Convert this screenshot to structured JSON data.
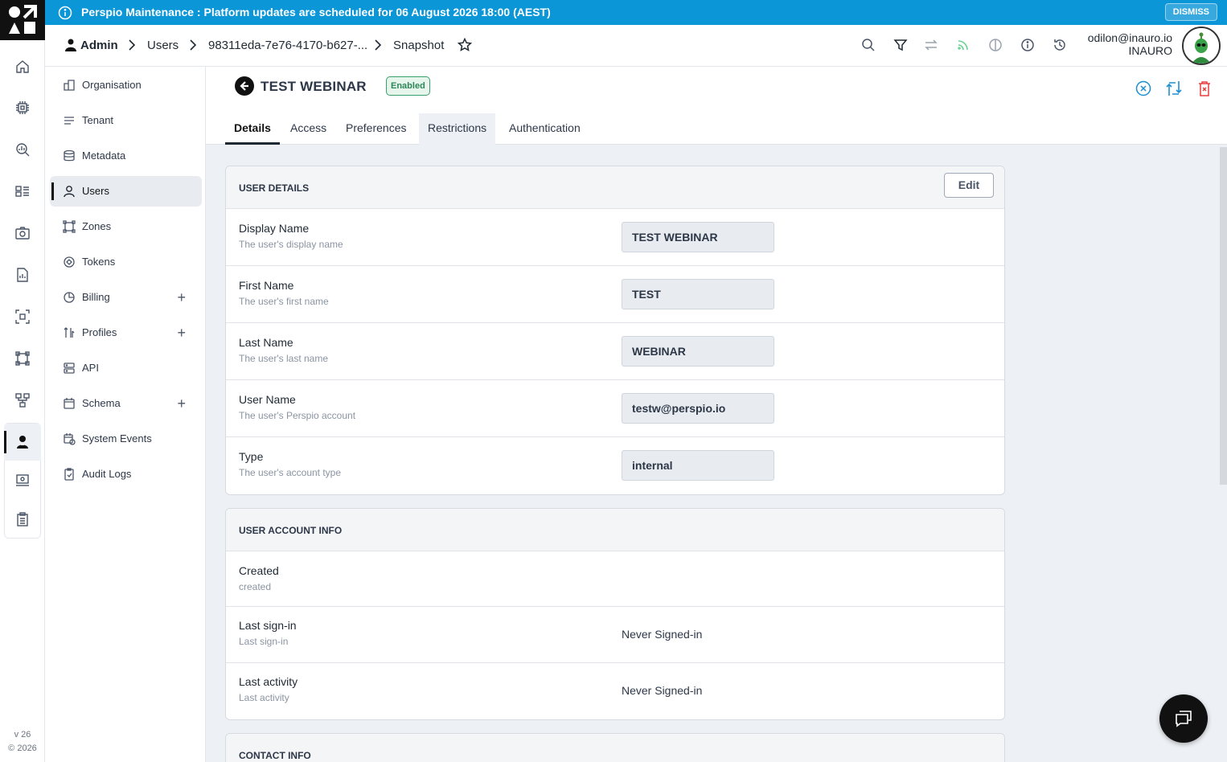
{
  "banner": {
    "message": "Perspio Maintenance : Platform updates are scheduled for 06 August 2026 18:00 (AEST)",
    "dismiss_label": "DISMISS"
  },
  "breadcrumb": {
    "root": "Admin",
    "items": [
      "Users",
      "98311eda-7e76-4170-b627-...",
      "Snapshot"
    ]
  },
  "user": {
    "email": "odilon@inauro.io",
    "org": "INAURO"
  },
  "rail": {
    "version": "v 26",
    "copyright": "© 2026"
  },
  "sidebar": {
    "items": [
      {
        "label": "Organisation",
        "icon": "organisation-icon"
      },
      {
        "label": "Tenant",
        "icon": "tenant-icon"
      },
      {
        "label": "Metadata",
        "icon": "database-icon"
      },
      {
        "label": "Users",
        "icon": "user-icon",
        "active": true
      },
      {
        "label": "Zones",
        "icon": "zones-icon"
      },
      {
        "label": "Tokens",
        "icon": "tokens-icon"
      },
      {
        "label": "Billing",
        "icon": "billing-icon",
        "expandable": true
      },
      {
        "label": "Profiles",
        "icon": "profiles-icon",
        "expandable": true
      },
      {
        "label": "API",
        "icon": "api-icon"
      },
      {
        "label": "Schema",
        "icon": "schema-icon",
        "expandable": true
      },
      {
        "label": "System Events",
        "icon": "system-events-icon"
      },
      {
        "label": "Audit Logs",
        "icon": "audit-logs-icon"
      }
    ],
    "plus": "+"
  },
  "page": {
    "title": "TEST WEBINAR",
    "status": "Enabled",
    "tabs": [
      "Details",
      "Access",
      "Preferences",
      "Restrictions",
      "Authentication"
    ]
  },
  "user_details": {
    "heading": "USER DETAILS",
    "edit_label": "Edit",
    "rows": [
      {
        "label": "Display Name",
        "desc": "The user's display name",
        "value": "TEST WEBINAR"
      },
      {
        "label": "First Name",
        "desc": "The user's first name",
        "value": "TEST"
      },
      {
        "label": "Last Name",
        "desc": "The user's last name",
        "value": "WEBINAR"
      },
      {
        "label": "User Name",
        "desc": "The user's Perspio account",
        "value": "testw@perspio.io"
      },
      {
        "label": "Type",
        "desc": "The user's account type",
        "value": "internal"
      }
    ]
  },
  "account_info": {
    "heading": "USER ACCOUNT INFO",
    "rows": [
      {
        "label": "Created",
        "desc": "created",
        "value": ""
      },
      {
        "label": "Last sign-in",
        "desc": "Last sign-in",
        "value": "Never Signed-in"
      },
      {
        "label": "Last activity",
        "desc": "Last activity",
        "value": "Never Signed-in"
      }
    ]
  },
  "contact_info": {
    "heading": "CONTACT INFO"
  },
  "colors": {
    "banner": "#0b96d8",
    "enabled_badge": "#38a169",
    "action_blue": "#1a8fd4",
    "delete_red": "#e53e3e"
  }
}
